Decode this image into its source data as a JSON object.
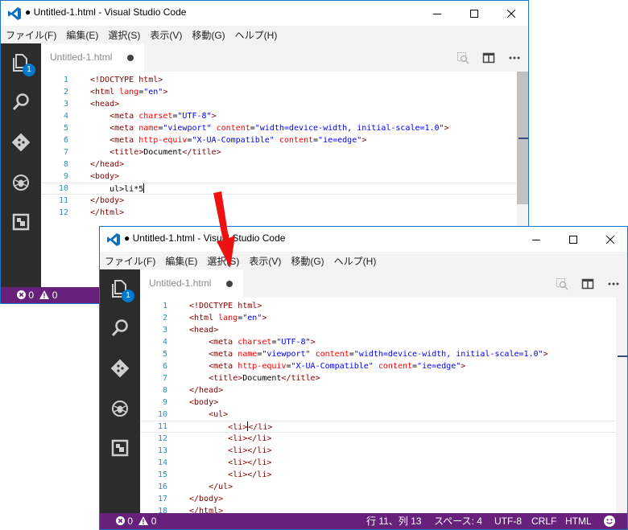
{
  "window": {
    "title": "● Untitled-1.html - Visual Studio Code"
  },
  "menu": [
    "ファイル(F)",
    "編集(E)",
    "選択(S)",
    "表示(V)",
    "移動(G)",
    "ヘルプ(H)"
  ],
  "activity": {
    "badge_count": "1",
    "icons": [
      "explorer-icon",
      "search-icon",
      "git-icon",
      "debug-icon",
      "extensions-icon"
    ]
  },
  "tab": {
    "label": "Untitled-1.html"
  },
  "before": {
    "lines": [
      {
        "n": "1",
        "seg": [
          [
            "t-tag",
            "<!DOCTYPE html>"
          ]
        ]
      },
      {
        "n": "2",
        "seg": [
          [
            "t-tag",
            "<html "
          ],
          [
            "t-attr",
            "lang"
          ],
          [
            "t-txt",
            "="
          ],
          [
            "t-val",
            "\"en\""
          ],
          [
            "t-tag",
            ">"
          ]
        ]
      },
      {
        "n": "3",
        "seg": [
          [
            "t-tag",
            "<head>"
          ]
        ]
      },
      {
        "n": "4",
        "seg": [
          [
            "t-txt",
            "    "
          ],
          [
            "t-tag",
            "<meta "
          ],
          [
            "t-attr",
            "charset"
          ],
          [
            "t-txt",
            "="
          ],
          [
            "t-val",
            "\"UTF-8\""
          ],
          [
            "t-tag",
            ">"
          ]
        ]
      },
      {
        "n": "5",
        "seg": [
          [
            "t-txt",
            "    "
          ],
          [
            "t-tag",
            "<meta "
          ],
          [
            "t-attr",
            "name"
          ],
          [
            "t-txt",
            "="
          ],
          [
            "t-val",
            "\"viewport\""
          ],
          [
            "t-txt",
            " "
          ],
          [
            "t-attr",
            "content"
          ],
          [
            "t-txt",
            "="
          ],
          [
            "t-val",
            "\"width=device-width, initial-scale=1.0\""
          ],
          [
            "t-tag",
            ">"
          ]
        ]
      },
      {
        "n": "6",
        "seg": [
          [
            "t-txt",
            "    "
          ],
          [
            "t-tag",
            "<meta "
          ],
          [
            "t-attr",
            "http-equiv"
          ],
          [
            "t-txt",
            "="
          ],
          [
            "t-val",
            "\"X-UA-Compatible\""
          ],
          [
            "t-txt",
            " "
          ],
          [
            "t-attr",
            "content"
          ],
          [
            "t-txt",
            "="
          ],
          [
            "t-val",
            "\"ie=edge\""
          ],
          [
            "t-tag",
            ">"
          ]
        ]
      },
      {
        "n": "7",
        "seg": [
          [
            "t-txt",
            "    "
          ],
          [
            "t-tag",
            "<title>"
          ],
          [
            "t-txt",
            "Document"
          ],
          [
            "t-tag",
            "</title>"
          ]
        ]
      },
      {
        "n": "8",
        "seg": [
          [
            "t-tag",
            "</head>"
          ]
        ]
      },
      {
        "n": "9",
        "seg": [
          [
            "t-tag",
            "<body>"
          ]
        ]
      },
      {
        "n": "10",
        "seg": [
          [
            "t-txt",
            "    ul>li*5"
          ]
        ],
        "cursor_end": true,
        "current": true
      },
      {
        "n": "11",
        "seg": [
          [
            "t-tag",
            "</body>"
          ]
        ]
      },
      {
        "n": "12",
        "seg": [
          [
            "t-tag",
            "</html>"
          ]
        ]
      }
    ],
    "status": {
      "errors": "0",
      "warnings": "0"
    }
  },
  "after": {
    "lines": [
      {
        "n": "1",
        "seg": [
          [
            "t-tag",
            "<!DOCTYPE html>"
          ]
        ]
      },
      {
        "n": "2",
        "seg": [
          [
            "t-tag",
            "<html "
          ],
          [
            "t-attr",
            "lang"
          ],
          [
            "t-txt",
            "="
          ],
          [
            "t-val",
            "\"en\""
          ],
          [
            "t-tag",
            ">"
          ]
        ]
      },
      {
        "n": "3",
        "seg": [
          [
            "t-tag",
            "<head>"
          ]
        ]
      },
      {
        "n": "4",
        "seg": [
          [
            "t-txt",
            "    "
          ],
          [
            "t-tag",
            "<meta "
          ],
          [
            "t-attr",
            "charset"
          ],
          [
            "t-txt",
            "="
          ],
          [
            "t-val",
            "\"UTF-8\""
          ],
          [
            "t-tag",
            ">"
          ]
        ]
      },
      {
        "n": "5",
        "seg": [
          [
            "t-txt",
            "    "
          ],
          [
            "t-tag",
            "<meta "
          ],
          [
            "t-attr",
            "name"
          ],
          [
            "t-txt",
            "="
          ],
          [
            "t-val",
            "\"viewport\""
          ],
          [
            "t-txt",
            " "
          ],
          [
            "t-attr",
            "content"
          ],
          [
            "t-txt",
            "="
          ],
          [
            "t-val",
            "\"width=device-width, initial-scale=1.0\""
          ],
          [
            "t-tag",
            ">"
          ]
        ]
      },
      {
        "n": "6",
        "seg": [
          [
            "t-txt",
            "    "
          ],
          [
            "t-tag",
            "<meta "
          ],
          [
            "t-attr",
            "http-equiv"
          ],
          [
            "t-txt",
            "="
          ],
          [
            "t-val",
            "\"X-UA-Compatible\""
          ],
          [
            "t-txt",
            " "
          ],
          [
            "t-attr",
            "content"
          ],
          [
            "t-txt",
            "="
          ],
          [
            "t-val",
            "\"ie=edge\""
          ],
          [
            "t-tag",
            ">"
          ]
        ]
      },
      {
        "n": "7",
        "seg": [
          [
            "t-txt",
            "    "
          ],
          [
            "t-tag",
            "<title>"
          ],
          [
            "t-txt",
            "Document"
          ],
          [
            "t-tag",
            "</title>"
          ]
        ]
      },
      {
        "n": "8",
        "seg": [
          [
            "t-tag",
            "</head>"
          ]
        ]
      },
      {
        "n": "9",
        "seg": [
          [
            "t-tag",
            "<body>"
          ]
        ]
      },
      {
        "n": "10",
        "seg": [
          [
            "t-txt",
            "    "
          ],
          [
            "t-tag",
            "<ul>"
          ]
        ]
      },
      {
        "n": "11",
        "seg": [
          [
            "t-txt",
            "        "
          ],
          [
            "t-tag",
            "<li>"
          ],
          [
            "cursor",
            ""
          ],
          [
            "t-tag",
            "</li>"
          ]
        ],
        "current": true
      },
      {
        "n": "12",
        "seg": [
          [
            "t-txt",
            "        "
          ],
          [
            "t-tag",
            "<li></li>"
          ]
        ]
      },
      {
        "n": "13",
        "seg": [
          [
            "t-txt",
            "        "
          ],
          [
            "t-tag",
            "<li></li>"
          ]
        ]
      },
      {
        "n": "14",
        "seg": [
          [
            "t-txt",
            "        "
          ],
          [
            "t-tag",
            "<li></li>"
          ]
        ]
      },
      {
        "n": "15",
        "seg": [
          [
            "t-txt",
            "        "
          ],
          [
            "t-tag",
            "<li></li>"
          ]
        ]
      },
      {
        "n": "16",
        "seg": [
          [
            "t-txt",
            "    "
          ],
          [
            "t-tag",
            "</ul>"
          ]
        ]
      },
      {
        "n": "17",
        "seg": [
          [
            "t-tag",
            "</body>"
          ]
        ]
      },
      {
        "n": "18",
        "seg": [
          [
            "t-tag",
            "</html>"
          ]
        ]
      }
    ],
    "status": {
      "errors": "0",
      "warnings": "0",
      "position": "行 11、列 13",
      "spaces": "スペース: 4",
      "encoding": "UTF-8",
      "eol": "CRLF",
      "language": "HTML"
    }
  },
  "colors": {
    "activity_bar": "#2c2c2c",
    "status_bar": "#68217a",
    "badge": "#007acc",
    "arrow": "#ee1111",
    "line_numbers": "#2b91af"
  }
}
